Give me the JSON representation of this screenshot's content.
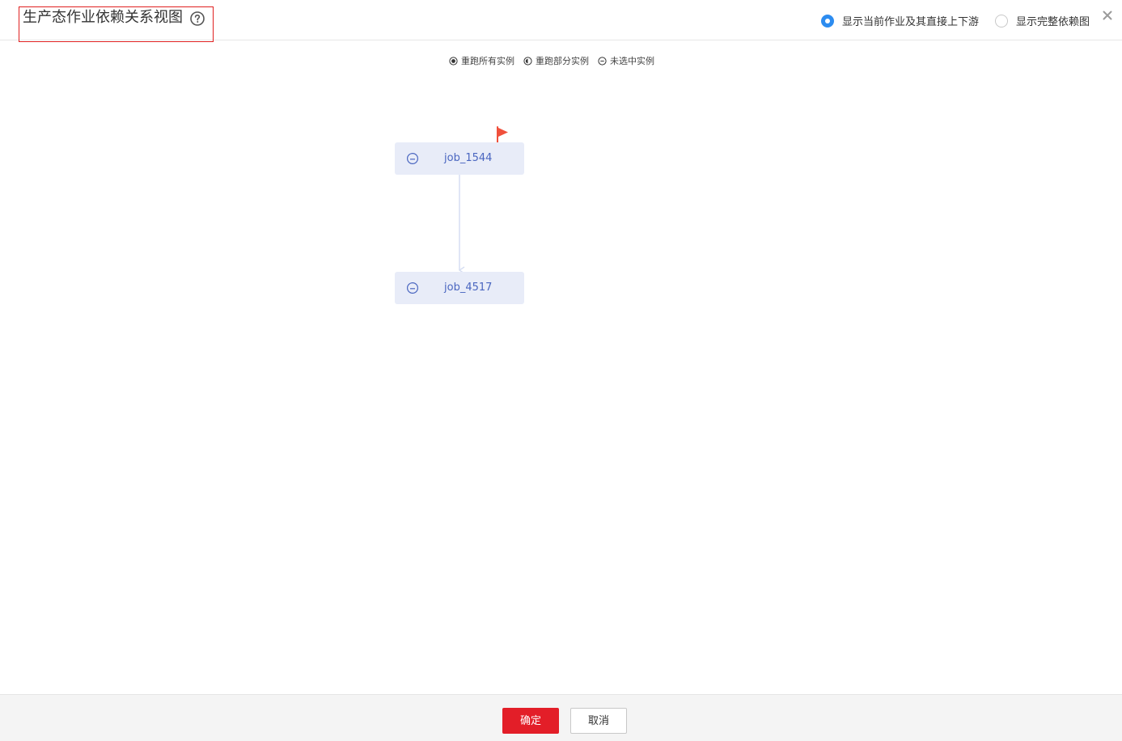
{
  "header": {
    "title": "生产态作业依赖关系视图",
    "help_icon": "question-circle-icon",
    "view_options": [
      {
        "label": "显示当前作业及其直接上下游",
        "checked": true
      },
      {
        "label": "显示完整依赖图",
        "checked": false
      }
    ],
    "close_icon": "close-icon"
  },
  "legend": [
    {
      "icon": "rerun-all-icon",
      "label": "重跑所有实例"
    },
    {
      "icon": "rerun-partial-icon",
      "label": "重跑部分实例"
    },
    {
      "icon": "unselected-icon",
      "label": "未选中实例"
    }
  ],
  "graph": {
    "nodes": [
      {
        "id": "job_1544",
        "label": "job_1544",
        "icon": "unselected-icon",
        "flagged": true
      },
      {
        "id": "job_4517",
        "label": "job_4517",
        "icon": "unselected-icon",
        "flagged": false
      }
    ],
    "edges": [
      {
        "from": "job_1544",
        "to": "job_4517"
      }
    ]
  },
  "colors": {
    "accent": "#2d8cf0",
    "danger": "#e31e28",
    "node_bg": "#e8ecf8",
    "node_text": "#4a66c0",
    "flag": "#f0503c"
  },
  "footer": {
    "ok_label": "确定",
    "cancel_label": "取消"
  }
}
